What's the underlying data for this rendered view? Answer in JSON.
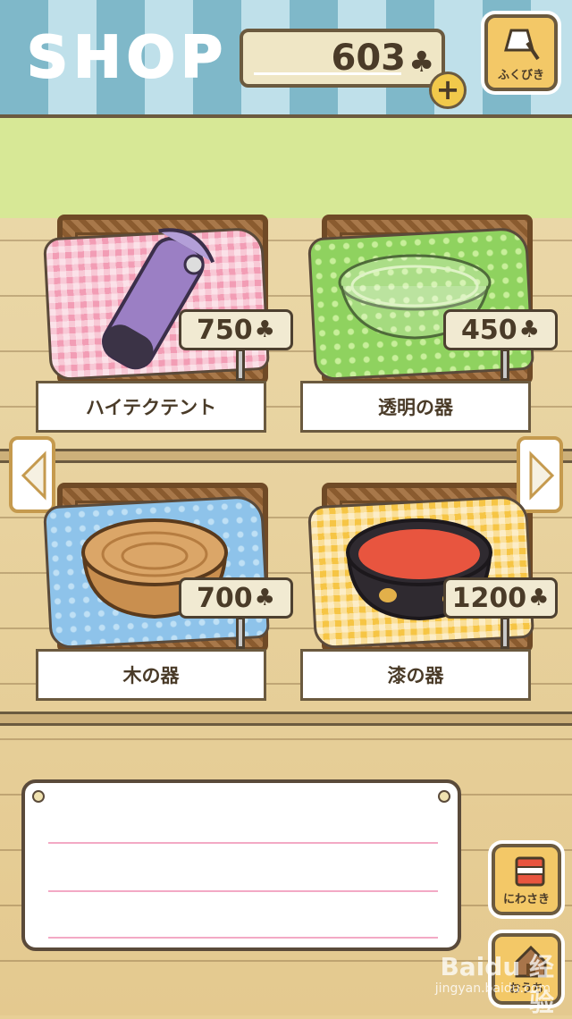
{
  "header": {
    "title": "SHOP",
    "clover_count": "603",
    "clover_symbol": "♣",
    "plus_label": "+",
    "lottery_label": "ふくびき"
  },
  "items": [
    {
      "name": "ハイテクテント",
      "price": "750",
      "cloth": "pink",
      "art": "tent-bag-icon"
    },
    {
      "name": "透明の器",
      "price": "450",
      "cloth": "green",
      "art": "glass-bowl-icon"
    },
    {
      "name": "木の器",
      "price": "700",
      "cloth": "blue",
      "art": "wooden-bowl-icon"
    },
    {
      "name": "漆の器",
      "price": "1200",
      "cloth": "yellow",
      "art": "lacquer-bowl-icon"
    }
  ],
  "nav": {
    "prev": "previous-page-arrow",
    "next": "next-page-arrow"
  },
  "message_board": {
    "text": ""
  },
  "side_buttons": {
    "yard_label": "にわさき",
    "home_label": "おうち"
  },
  "watermark": {
    "text": "Baidu 经验",
    "url": "jingyan.baidu.com"
  }
}
